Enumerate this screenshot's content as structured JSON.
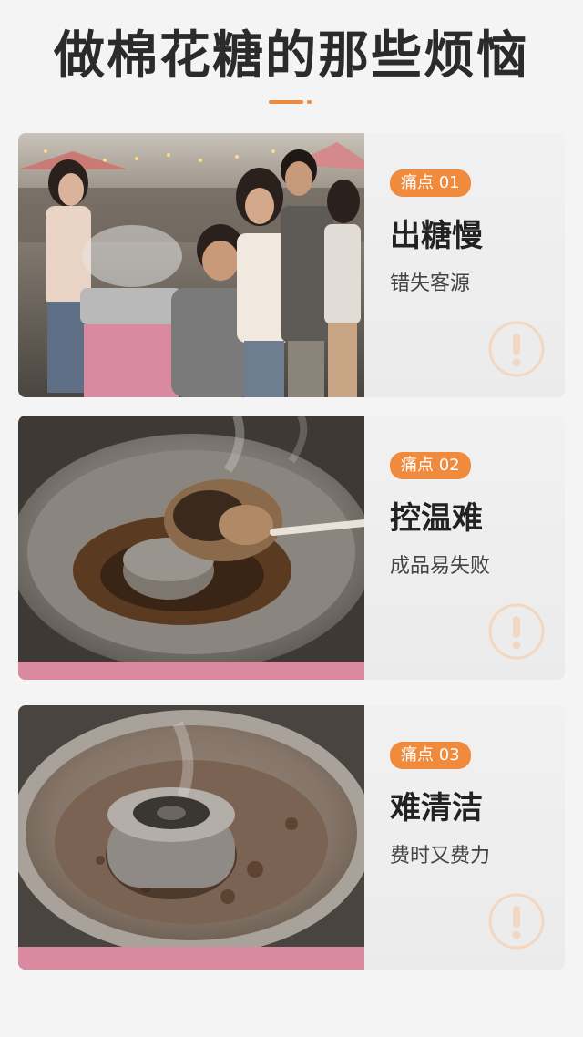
{
  "page": {
    "title": "做棉花糖的那些烦恼"
  },
  "colors": {
    "accent": "#f08a3c",
    "background": "#f4f4f4",
    "title": "#2b2b2b"
  },
  "cards": [
    {
      "badge": "痛点 01",
      "heading": "出糖慢",
      "sub": "错失客源",
      "photo": "market-queue-photo",
      "icon": "warning-icon"
    },
    {
      "badge": "痛点 02",
      "heading": "控温难",
      "sub": "成品易失败",
      "photo": "burnt-sugar-photo",
      "icon": "warning-icon"
    },
    {
      "badge": "痛点 03",
      "heading": "难清洁",
      "sub": "费时又费力",
      "photo": "dirty-machine-photo",
      "icon": "warning-icon"
    }
  ]
}
